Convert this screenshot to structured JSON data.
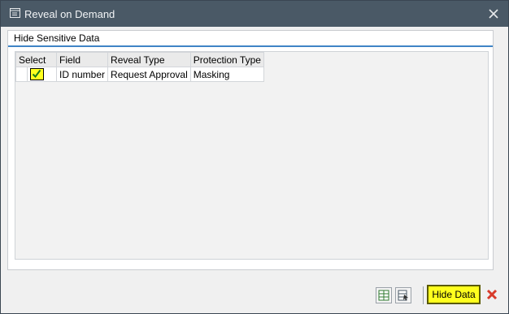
{
  "window": {
    "title": "Reveal on Demand"
  },
  "group": {
    "title": "Hide Sensitive Data"
  },
  "table": {
    "headers": [
      "Select",
      "Field",
      "Reveal Type",
      "Protection Type"
    ],
    "rows": [
      {
        "selected": true,
        "field": "ID number",
        "reveal_type": "Request Approval",
        "protection_type": "Masking"
      }
    ]
  },
  "footer": {
    "primary_label": "Hide Data"
  },
  "colors": {
    "titlebar": "#4a5966",
    "accent": "#3f84c6",
    "highlight": "#ffff1e",
    "cancel": "#d83b2b"
  },
  "icons": {
    "title": "edit-window-icon",
    "close": "close-icon",
    "tool1": "table-export-icon",
    "tool2": "table-export-select-icon",
    "cancel": "cancel-x-icon"
  }
}
